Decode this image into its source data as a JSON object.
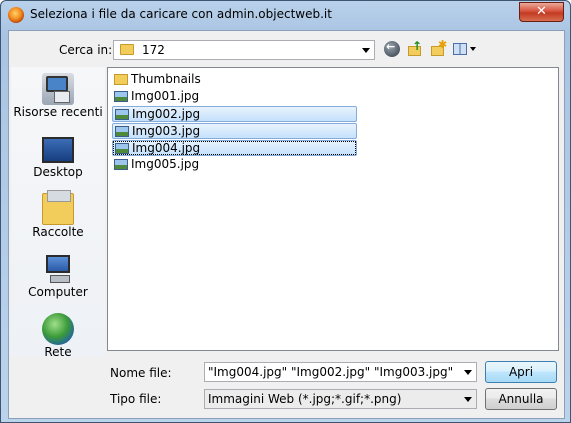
{
  "window": {
    "title": "Seleziona i file da caricare con admin.objectweb.it",
    "close_glyph": "✕"
  },
  "toolbar": {
    "look_in_label": "Cerca in:",
    "look_in_value": "172",
    "icons": [
      "back-icon",
      "up-folder-icon",
      "new-folder-icon",
      "view-menu-icon"
    ]
  },
  "places": [
    {
      "label": "Risorse recenti",
      "icon": "recent-places-icon"
    },
    {
      "label": "Desktop",
      "icon": "desktop-icon"
    },
    {
      "label": "Raccolte",
      "icon": "libraries-icon"
    },
    {
      "label": "Computer",
      "icon": "computer-icon"
    },
    {
      "label": "Rete",
      "icon": "network-icon"
    }
  ],
  "files": [
    {
      "name": "Thumbnails",
      "type": "folder",
      "selected": false
    },
    {
      "name": "Img001.jpg",
      "type": "image",
      "selected": false
    },
    {
      "name": "Img002.jpg",
      "type": "image",
      "selected": true
    },
    {
      "name": "Img003.jpg",
      "type": "image",
      "selected": true
    },
    {
      "name": "Img004.jpg",
      "type": "image",
      "selected": true,
      "focused": true
    },
    {
      "name": "Img005.jpg",
      "type": "image",
      "selected": false
    }
  ],
  "filename": {
    "label": "Nome file:",
    "value": "\"Img004.jpg\" \"Img002.jpg\" \"Img003.jpg\""
  },
  "filetype": {
    "label": "Tipo file:",
    "value": "Immagini Web (*.jpg;*.gif;*.png)"
  },
  "buttons": {
    "open": "Apri",
    "cancel": "Annulla"
  }
}
